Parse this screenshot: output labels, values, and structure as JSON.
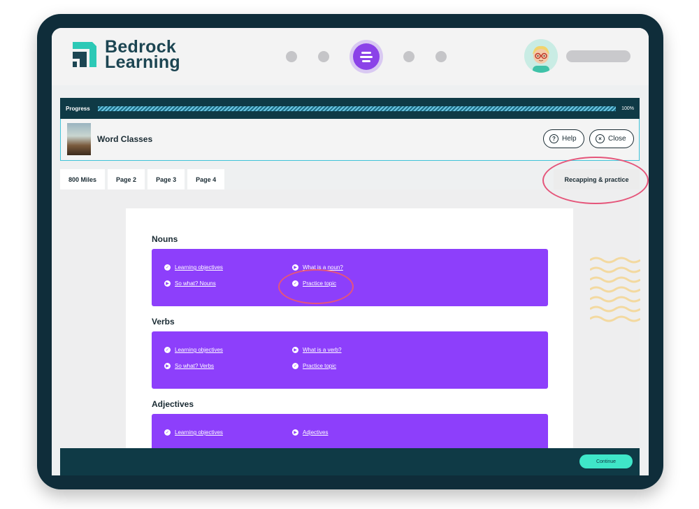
{
  "brand": {
    "name_line1": "Bedrock",
    "name_line2": "Learning"
  },
  "progress": {
    "label": "Progress",
    "value_percent": 100,
    "value_text": "100%"
  },
  "lesson": {
    "title": "Word Classes",
    "help_label": "Help",
    "close_label": "Close"
  },
  "tabs": [
    {
      "label": "800 Miles"
    },
    {
      "label": "Page 2"
    },
    {
      "label": "Page 3"
    },
    {
      "label": "Page 4"
    }
  ],
  "recap_tab": {
    "label": "Recapping & practice"
  },
  "sections": [
    {
      "title": "Nouns",
      "links": [
        {
          "label": "Learning objectives",
          "icon": "check-icon"
        },
        {
          "label": "What is a noun?",
          "icon": "play-icon"
        },
        {
          "label": "So what? Nouns",
          "icon": "play-icon"
        },
        {
          "label": "Practice topic",
          "icon": "check-icon"
        }
      ]
    },
    {
      "title": "Verbs",
      "links": [
        {
          "label": "Learning objectives",
          "icon": "check-icon"
        },
        {
          "label": "What is a verb?",
          "icon": "play-icon"
        },
        {
          "label": "So what? Verbs",
          "icon": "play-icon"
        },
        {
          "label": "Practice topic",
          "icon": "check-icon"
        }
      ]
    },
    {
      "title": "Adjectives",
      "links": [
        {
          "label": "Learning objectives",
          "icon": "check-icon"
        },
        {
          "label": "Adjectives",
          "icon": "play-icon"
        }
      ]
    }
  ],
  "footer": {
    "continue_label": "Continue"
  },
  "colors": {
    "accent": "#8d3ffb",
    "dark": "#0f3a46",
    "highlight": "#e5557a",
    "continue": "#3fe6c8"
  }
}
